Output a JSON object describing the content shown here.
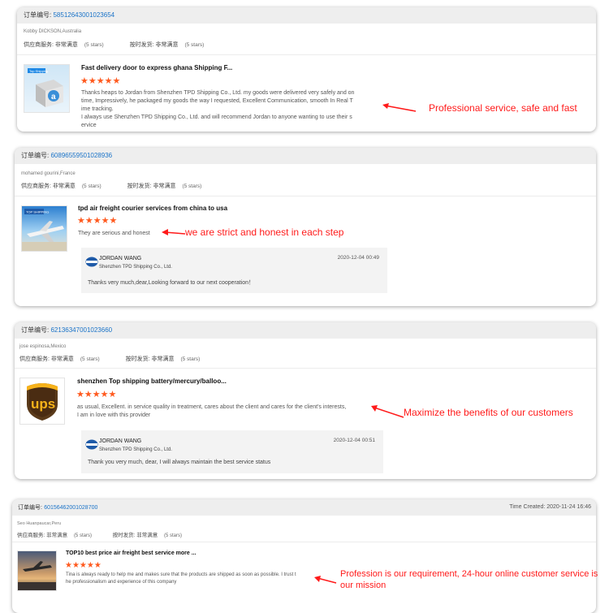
{
  "cards": [
    {
      "order_label": "订单编号:",
      "order_number": "58512643001023654",
      "buyer": "Kobby DICKSON,Australia",
      "supplier_service_label": "供应商服务:",
      "supplier_service_value": "非常满意",
      "supplier_stars_note": "(5 stars)",
      "shipping_label": "按时发货:",
      "shipping_value": "非常满意",
      "shipping_stars_note": "(5 stars)",
      "product_title": "Fast delivery door to express ghana Shipping F...",
      "stars": "★★★★★",
      "review_lines": [
        "Thanks heaps to Jordan from Shenzhen TPD Shipping Co., Ltd. my goods were delivered very safely and on",
        "time, Impressively, he packaged my goods the way I requested, Excellent Communication, smooth In Real T",
        "ime tracking.",
        "I always use Shenzhen TPD Shipping Co., Ltd. and will recommend Jordan to anyone wanting to use their s",
        "ervice"
      ],
      "thumb_logo_text": "Top Shipping",
      "annotation": "Professional service, safe and fast"
    },
    {
      "order_label": "订单编号:",
      "order_number": "60896559501028936",
      "buyer": "mohamed gourini,France",
      "supplier_service_label": "供应商服务:",
      "supplier_service_value": "非常满意",
      "supplier_stars_note": "(5 stars)",
      "shipping_label": "按时发货:",
      "shipping_value": "非常满意",
      "shipping_stars_note": "(5 stars)",
      "product_title": "tpd air freight courier services from china to usa",
      "stars": "★★★★★",
      "review_lines": [
        "They are serious and honest"
      ],
      "thumb_logo_text": "TOP SHIPPING",
      "annotation": "we are strict and honest in each step",
      "reply": {
        "name": "JORDAN WANG",
        "company": "Shenzhen TPD Shipping Co., Ltd.",
        "date": "2020-12-04 00:49",
        "text": "Thanks very much,dear,Looking forward to our next cooperation！"
      }
    },
    {
      "order_label": "订单编号:",
      "order_number": "62136347001023660",
      "buyer": "jose espinosa,Mexico",
      "supplier_service_label": "供应商服务:",
      "supplier_service_value": "非常满意",
      "supplier_stars_note": "(5 stars)",
      "shipping_label": "按时发货:",
      "shipping_value": "非常满意",
      "shipping_stars_note": "(5 stars)",
      "product_title": "shenzhen Top shipping battery/mercury/balloo...",
      "stars": "★★★★★",
      "review_lines": [
        "as usual, Excellent. in service quality in treatment, cares about the client and cares for the client's interests,",
        "I am in love with this provider"
      ],
      "thumb_logo_text": "ups",
      "annotation": "Maximize the benefits of our customers",
      "reply": {
        "name": "JORDAN WANG",
        "company": "Shenzhen TPD Shipping Co., Ltd.",
        "date": "2020-12-04 00:51",
        "text": "Thank you very much, dear, I will always maintain the best service status"
      }
    },
    {
      "order_label": "订单编号:",
      "order_number": "60156462001028700",
      "time_created": "Time Created: 2020-11-24 16:46",
      "buyer": "Seo Huanpaucar,Peru",
      "supplier_service_label": "供应商服务:",
      "supplier_service_value": "非常满意",
      "supplier_stars_note": "(5 stars)",
      "shipping_label": "按时发货:",
      "shipping_value": "非常满意",
      "shipping_stars_note": "(5 stars)",
      "product_title": "TOP10 best price air freight best service more ...",
      "stars": "★★★★★",
      "review_lines": [
        "Tina is always ready to help me and makes sure that the products are shipped as soon as possible. I trust t",
        "he professionalism and experience of this company"
      ],
      "annotation_lines": [
        "Profession is our requirement, 24-hour online customer service is",
        "our mission"
      ]
    }
  ],
  "colors": {
    "star": "#ff5a1f",
    "order_number": "#1a73c8",
    "annotation": "#ff1a1a",
    "order_bar": "#eeeeee"
  }
}
